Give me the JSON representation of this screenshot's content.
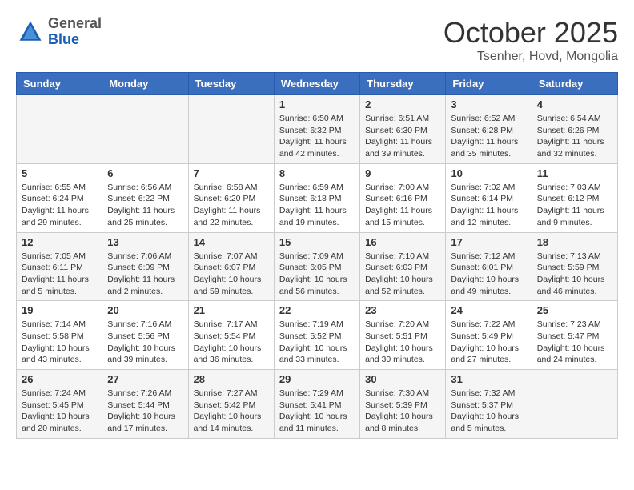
{
  "header": {
    "logo_general": "General",
    "logo_blue": "Blue",
    "month_title": "October 2025",
    "location": "Tsenher, Hovd, Mongolia"
  },
  "days_of_week": [
    "Sunday",
    "Monday",
    "Tuesday",
    "Wednesday",
    "Thursday",
    "Friday",
    "Saturday"
  ],
  "weeks": [
    [
      {
        "day": "",
        "info": ""
      },
      {
        "day": "",
        "info": ""
      },
      {
        "day": "",
        "info": ""
      },
      {
        "day": "1",
        "info": "Sunrise: 6:50 AM\nSunset: 6:32 PM\nDaylight: 11 hours and 42 minutes."
      },
      {
        "day": "2",
        "info": "Sunrise: 6:51 AM\nSunset: 6:30 PM\nDaylight: 11 hours and 39 minutes."
      },
      {
        "day": "3",
        "info": "Sunrise: 6:52 AM\nSunset: 6:28 PM\nDaylight: 11 hours and 35 minutes."
      },
      {
        "day": "4",
        "info": "Sunrise: 6:54 AM\nSunset: 6:26 PM\nDaylight: 11 hours and 32 minutes."
      }
    ],
    [
      {
        "day": "5",
        "info": "Sunrise: 6:55 AM\nSunset: 6:24 PM\nDaylight: 11 hours and 29 minutes."
      },
      {
        "day": "6",
        "info": "Sunrise: 6:56 AM\nSunset: 6:22 PM\nDaylight: 11 hours and 25 minutes."
      },
      {
        "day": "7",
        "info": "Sunrise: 6:58 AM\nSunset: 6:20 PM\nDaylight: 11 hours and 22 minutes."
      },
      {
        "day": "8",
        "info": "Sunrise: 6:59 AM\nSunset: 6:18 PM\nDaylight: 11 hours and 19 minutes."
      },
      {
        "day": "9",
        "info": "Sunrise: 7:00 AM\nSunset: 6:16 PM\nDaylight: 11 hours and 15 minutes."
      },
      {
        "day": "10",
        "info": "Sunrise: 7:02 AM\nSunset: 6:14 PM\nDaylight: 11 hours and 12 minutes."
      },
      {
        "day": "11",
        "info": "Sunrise: 7:03 AM\nSunset: 6:12 PM\nDaylight: 11 hours and 9 minutes."
      }
    ],
    [
      {
        "day": "12",
        "info": "Sunrise: 7:05 AM\nSunset: 6:11 PM\nDaylight: 11 hours and 5 minutes."
      },
      {
        "day": "13",
        "info": "Sunrise: 7:06 AM\nSunset: 6:09 PM\nDaylight: 11 hours and 2 minutes."
      },
      {
        "day": "14",
        "info": "Sunrise: 7:07 AM\nSunset: 6:07 PM\nDaylight: 10 hours and 59 minutes."
      },
      {
        "day": "15",
        "info": "Sunrise: 7:09 AM\nSunset: 6:05 PM\nDaylight: 10 hours and 56 minutes."
      },
      {
        "day": "16",
        "info": "Sunrise: 7:10 AM\nSunset: 6:03 PM\nDaylight: 10 hours and 52 minutes."
      },
      {
        "day": "17",
        "info": "Sunrise: 7:12 AM\nSunset: 6:01 PM\nDaylight: 10 hours and 49 minutes."
      },
      {
        "day": "18",
        "info": "Sunrise: 7:13 AM\nSunset: 5:59 PM\nDaylight: 10 hours and 46 minutes."
      }
    ],
    [
      {
        "day": "19",
        "info": "Sunrise: 7:14 AM\nSunset: 5:58 PM\nDaylight: 10 hours and 43 minutes."
      },
      {
        "day": "20",
        "info": "Sunrise: 7:16 AM\nSunset: 5:56 PM\nDaylight: 10 hours and 39 minutes."
      },
      {
        "day": "21",
        "info": "Sunrise: 7:17 AM\nSunset: 5:54 PM\nDaylight: 10 hours and 36 minutes."
      },
      {
        "day": "22",
        "info": "Sunrise: 7:19 AM\nSunset: 5:52 PM\nDaylight: 10 hours and 33 minutes."
      },
      {
        "day": "23",
        "info": "Sunrise: 7:20 AM\nSunset: 5:51 PM\nDaylight: 10 hours and 30 minutes."
      },
      {
        "day": "24",
        "info": "Sunrise: 7:22 AM\nSunset: 5:49 PM\nDaylight: 10 hours and 27 minutes."
      },
      {
        "day": "25",
        "info": "Sunrise: 7:23 AM\nSunset: 5:47 PM\nDaylight: 10 hours and 24 minutes."
      }
    ],
    [
      {
        "day": "26",
        "info": "Sunrise: 7:24 AM\nSunset: 5:45 PM\nDaylight: 10 hours and 20 minutes."
      },
      {
        "day": "27",
        "info": "Sunrise: 7:26 AM\nSunset: 5:44 PM\nDaylight: 10 hours and 17 minutes."
      },
      {
        "day": "28",
        "info": "Sunrise: 7:27 AM\nSunset: 5:42 PM\nDaylight: 10 hours and 14 minutes."
      },
      {
        "day": "29",
        "info": "Sunrise: 7:29 AM\nSunset: 5:41 PM\nDaylight: 10 hours and 11 minutes."
      },
      {
        "day": "30",
        "info": "Sunrise: 7:30 AM\nSunset: 5:39 PM\nDaylight: 10 hours and 8 minutes."
      },
      {
        "day": "31",
        "info": "Sunrise: 7:32 AM\nSunset: 5:37 PM\nDaylight: 10 hours and 5 minutes."
      },
      {
        "day": "",
        "info": ""
      }
    ]
  ]
}
